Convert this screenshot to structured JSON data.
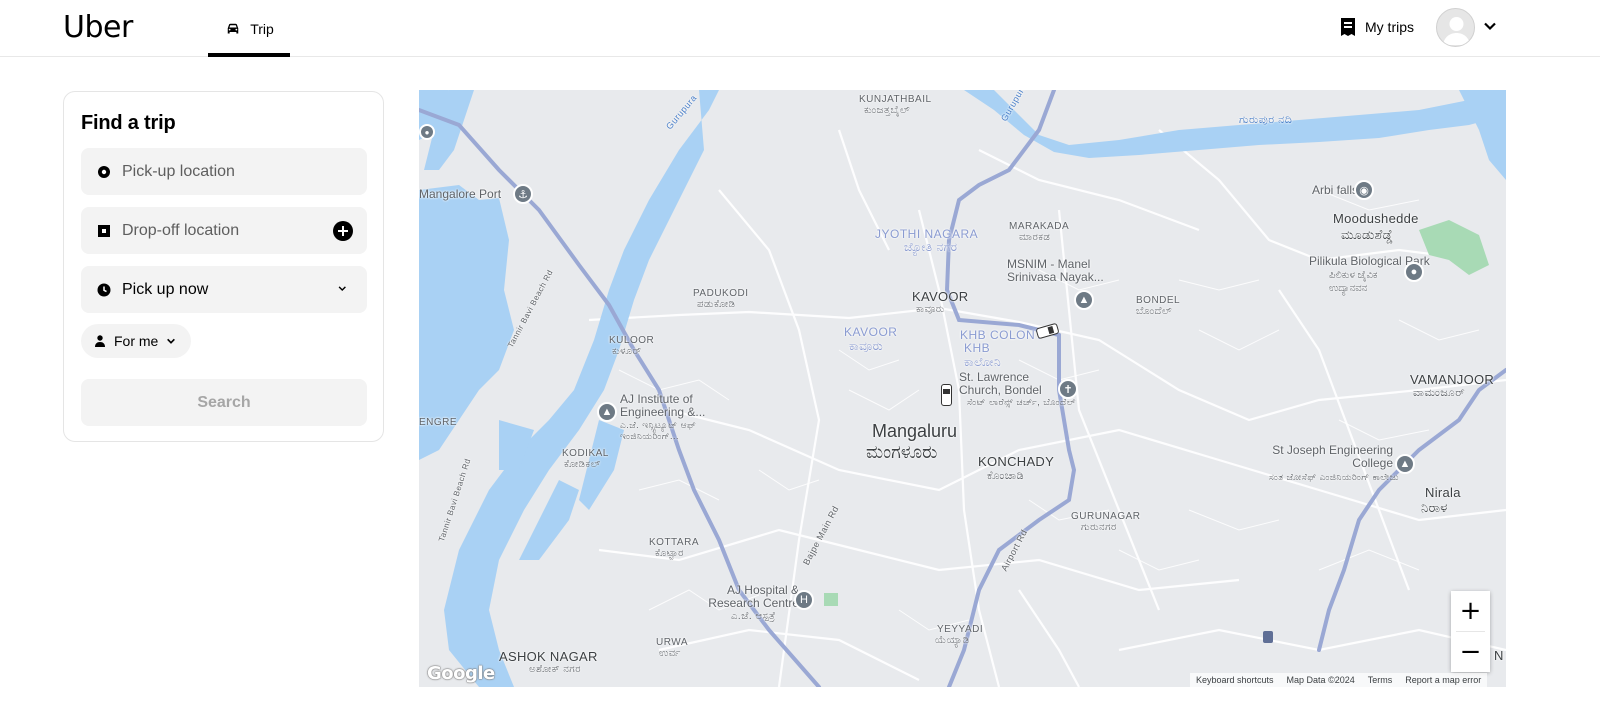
{
  "header": {
    "logo": "Uber",
    "tab_trip": "Trip",
    "my_trips": "My trips"
  },
  "card": {
    "title": "Find a trip",
    "pickup_placeholder": "Pick-up location",
    "dropoff_placeholder": "Drop-off location",
    "pickup_time": "Pick up now",
    "rider": "For me",
    "search": "Search"
  },
  "map": {
    "labels": {
      "kunjathbail": "KUNJATHBAIL",
      "kunjathbail_kn": "ಕುಂಜತ್ತಬೈಲ್",
      "gurupura_river": "ಗುರುಪುರ ನದಿ",
      "mangalore_port": "Mangalore Port",
      "jyothi_nagara": "JYOTHI NAGARA",
      "jyothi_nagara_kn": "ಜ್ಯೋತಿ ನಗರ",
      "marakada": "MARAKADA",
      "marakada_kn": "ಮಾರಕಡ",
      "msnim": "MSNIM - Manel Srinivasa Nayak...",
      "arbi_falls": "Arbi falls",
      "moodushedde": "Moodushedde",
      "moodushedde_kn": "ಮೂಡುಶೆಡ್ಡೆ",
      "pilikula": "Pilikula Biological Park",
      "pilikula_kn": "ಪಿಲಿಕುಳ ಜೈವಿಕ ಉದ್ಯಾನವನ",
      "padukodi": "PADUKODI",
      "padukodi_kn": "ಪಡುಕೋಡಿ",
      "kavoor": "KAVOOR",
      "kavoor_kn": "ಕಾವೂರು",
      "kavoor_blue": "KAVOOR",
      "kavoor_blue_kn": "ಕಾವೂರು",
      "khb_colony": "KHB COLONY",
      "khb_colony_kn": "KHB ಕಾಲೋನಿ",
      "bondel": "BONDEL",
      "bondel_kn": "ಬೊಂದೆಲ್",
      "kuloor": "KULOOR",
      "kuloor_kn": "ಕುಳೂರ್",
      "st_lawrence": "St. Lawrence Church, Bondel",
      "st_lawrence_kn": "ಸೆಂಟ್ ಲಾರೆನ್ಸ್ ಚರ್ಚ್, ಬೊಂದೆಲ್",
      "vamanjoor": "VAMANJOOR",
      "vamanjoor_kn": "ವಾಮಂಜೂರ್",
      "aj_institute": "AJ Institute of Engineering &...",
      "aj_institute_kn": "ಎ.ಜೆ. ಇನ್ಸ್ಟಿಟ್ಯೂಟ್ ಆಫ್ ಇಂಜಿನಿಯರಿಂಗ್...",
      "engre": "ENGRE",
      "mangaluru": "Mangaluru",
      "mangaluru_kn": "ಮಂಗಳೂರು",
      "konchady": "KONCHADY",
      "konchady_kn": "ಕೊಂಚಾಡಿ",
      "st_joseph": "St Joseph Engineering College",
      "st_joseph_kn": "ಸಂತ ಜೋಸೆಫ್ ಎಂಜಿನಿಯರಿಂಗ್ ಕಾಲೇಜು",
      "kodikal": "KODIKAL",
      "kodikal_kn": "ಕೋಡಿಕಲ್",
      "nirala": "Nirala",
      "nirala_kn": "ನಿರಾಳ",
      "gurunagar": "GURUNAGAR",
      "gurunagar_kn": "ಗುರುನಗರ",
      "kottara": "KOTTARA",
      "kottara_kn": "ಕೊಟ್ಟಾರ",
      "aj_hospital": "AJ Hospital & Research Centre",
      "aj_hospital_kn": "ಎ.ಜೆ. ಆಸ್ಪತ್ರೆ",
      "urwa": "URWA",
      "urwa_kn": "ಉರ್ವ",
      "yeyyadi": "YEYYADI",
      "yeyyadi_kn": "ಯೆಯ್ಯಾಡಿ",
      "ashok_nagar": "ASHOK NAGAR",
      "ashok_nagar_kn": "ಅಶೋಕ್ ನಗರ",
      "tannir_bavi_1": "Tannir Bavi Beach Rd",
      "tannir_bavi_2": "Tannir Bavi Beach Rd",
      "airport_rd": "Airport Rd",
      "bajpe_rd": "Bajpe Main Rd",
      "gurupura_label": "Gurupura",
      "gurupura_label2": "Gurupura River",
      "edge_n": "N"
    },
    "zoom_in": "+",
    "zoom_out": "−",
    "google": "Google",
    "attribution": {
      "shortcuts": "Keyboard shortcuts",
      "data": "Map Data ©2024",
      "terms": "Terms",
      "report": "Report a map error"
    }
  }
}
